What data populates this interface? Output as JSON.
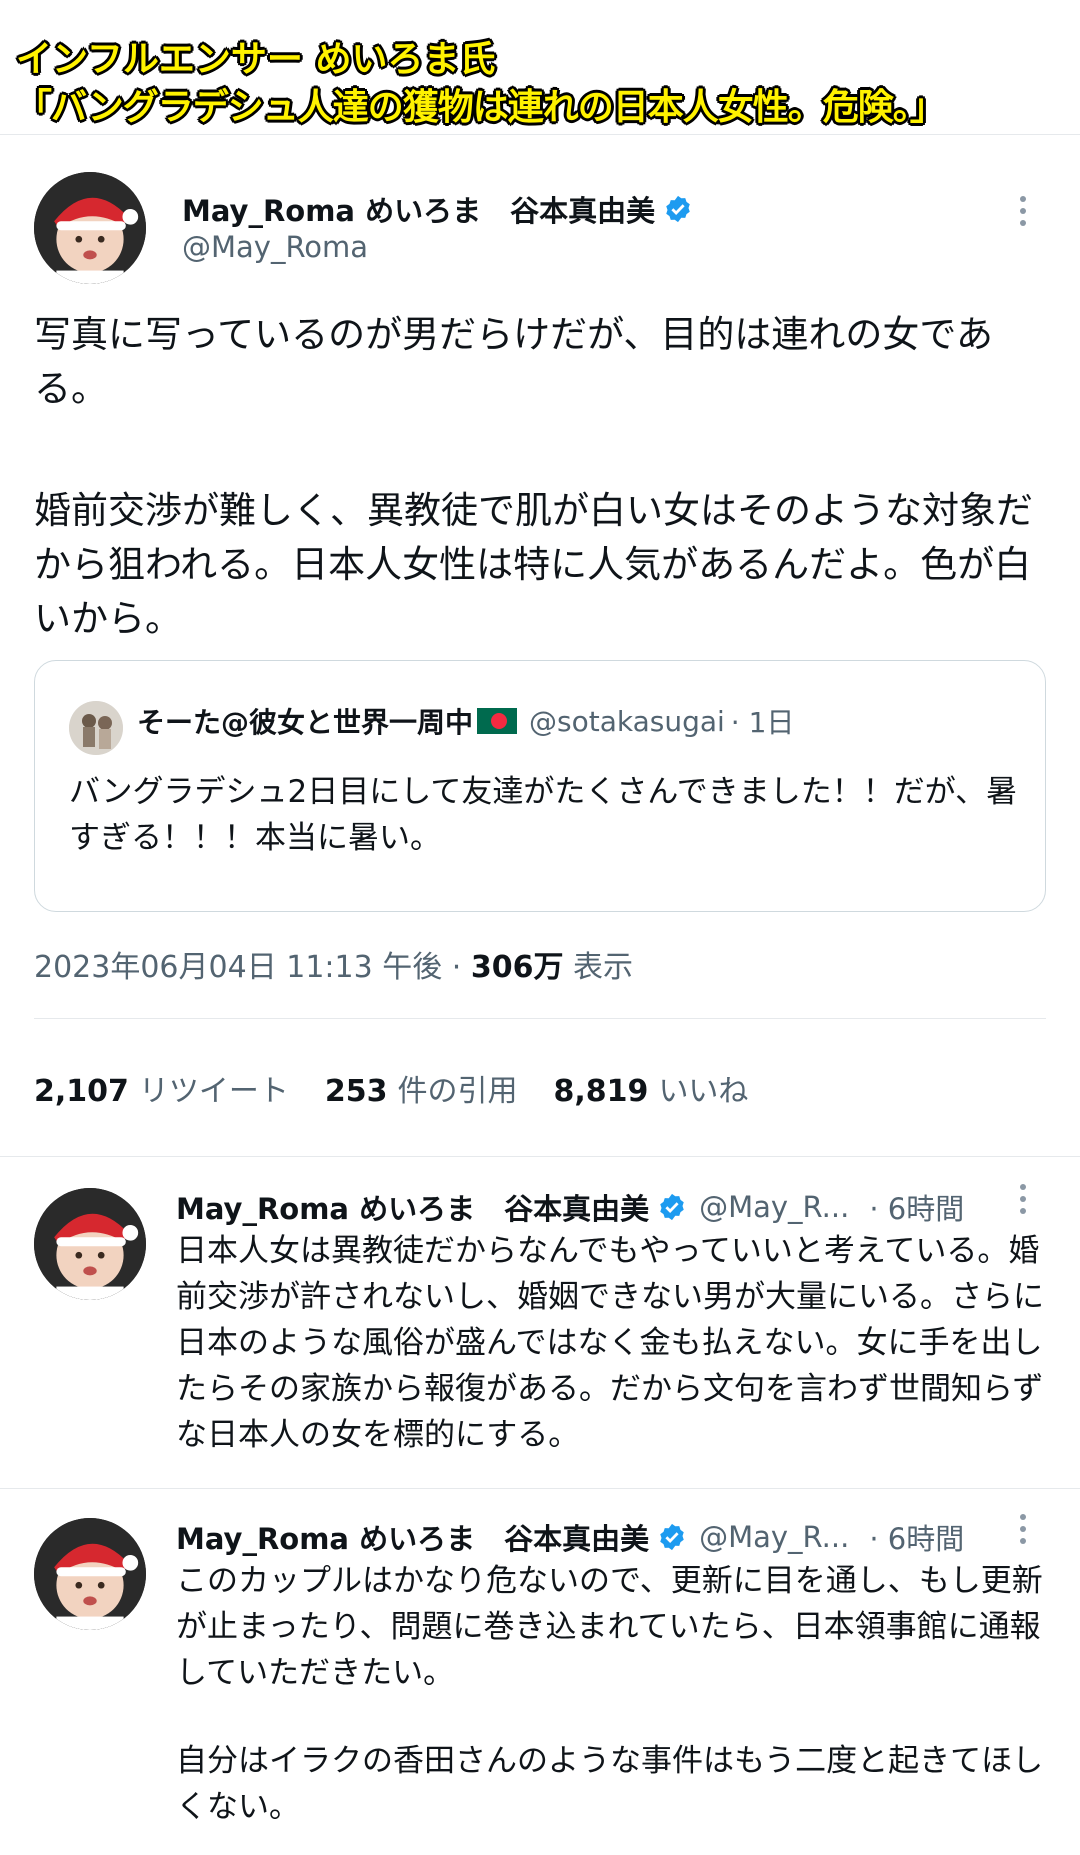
{
  "banner": {
    "line1": "インフルエンサー めいろま氏",
    "line2": "「バングラデシュ人達の獲物は連れの日本人女性。危険。」"
  },
  "main_tweet": {
    "display_name": "May_Roma めいろま　谷本真由美",
    "handle": "@May_Roma",
    "paragraphs": [
      "写真に写っているのが男だらけだが、目的は連れの女である。",
      "婚前交渉が難しく、異教徒で肌が白い女はそのような対象だから狙われる。日本人女性は特に人気があるんだよ。色が白いから。"
    ],
    "quote": {
      "name": "そーた@彼女と世界一周中",
      "handle": "@sotakasugai",
      "time": "· 1日",
      "text": "バングラデシュ2日目にして友達がたくさんできました！！だが、暑すぎる！！！本当に暑い。"
    },
    "timestamp": "2023年06月04日 11:13 午後 · ",
    "views_count": "306万",
    "views_label": " 表示",
    "stats": {
      "retweets": "2,107",
      "retweets_label": "リツイート",
      "quotes": "253",
      "quotes_label": "件の引用",
      "likes": "8,819",
      "likes_label": "いいね"
    }
  },
  "replies": [
    {
      "display_name": "May_Roma めいろま　谷本真由美",
      "handle": "@May_R...",
      "time": "· 6時間",
      "text": "日本人女は異教徒だからなんでもやっていいと考えている。婚前交渉が許されないし、婚姻できない男が大量にいる。さらに日本のような風俗が盛んではなく金も払えない。女に手を出したらその家族から報復がある。だから文句を言わず世間知らずな日本人の女を標的にする。"
    },
    {
      "display_name": "May_Roma めいろま　谷本真由美",
      "handle": "@May_R...",
      "time": "· 6時間",
      "text1": "このカップルはかなり危ないので、更新に目を通し、もし更新が止まったり、問題に巻き込まれていたら、日本領事館に通報していただきたい。",
      "text2": "自分はイラクの香田さんのような事件はもう二度と起きてほしくない。"
    }
  ],
  "colors": {
    "banner_text": "#fff200",
    "verified": "#1d9bf0",
    "secondary_text": "#536471"
  }
}
